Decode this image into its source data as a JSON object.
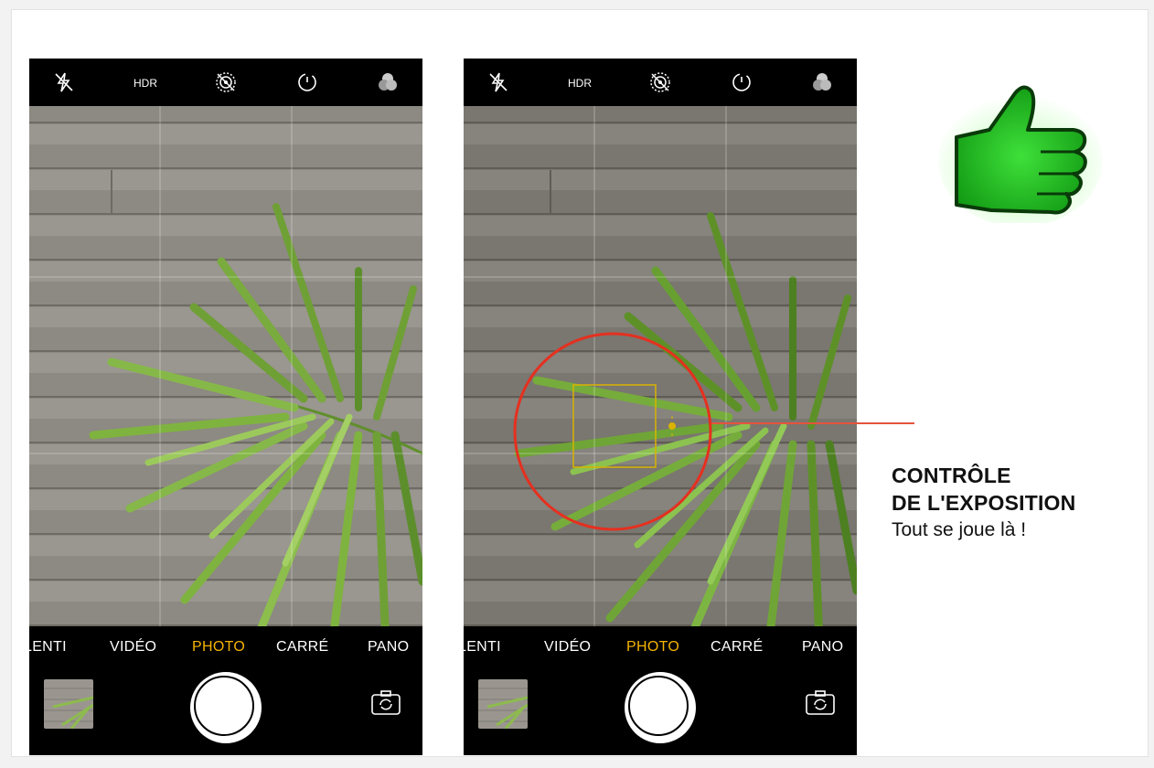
{
  "phones": [
    {
      "modes": [
        "LENTI",
        "VIDÉO",
        "PHOTO",
        "CARRÉ",
        "PANO"
      ],
      "active_mode": "PHOTO",
      "top_icons": [
        "flash-off-icon",
        "live-photo-icon",
        "focus-icon",
        "timer-icon",
        "filters-icon"
      ],
      "exposure_slider": null
    },
    {
      "modes": [
        "LENTI",
        "VIDÉO",
        "PHOTO",
        "CARRÉ",
        "PANO"
      ],
      "active_mode": "PHOTO",
      "top_icons": [
        "flash-off-icon",
        "live-photo-icon",
        "focus-icon",
        "timer-icon",
        "filters-icon"
      ],
      "exposure_slider": {
        "minus_label": "−",
        "plus_label": "+",
        "level": 0.2
      }
    }
  ],
  "callout": {
    "line1": "CONTRÔLE",
    "line2": "DE L'EXPOSITION",
    "line3": "Tout se joue là !"
  },
  "colors": {
    "active_mode": "#f5b400",
    "highlight_circle": "#e5301f",
    "focus_square": "#d9b300",
    "thumbs_up": "#1fb320"
  }
}
